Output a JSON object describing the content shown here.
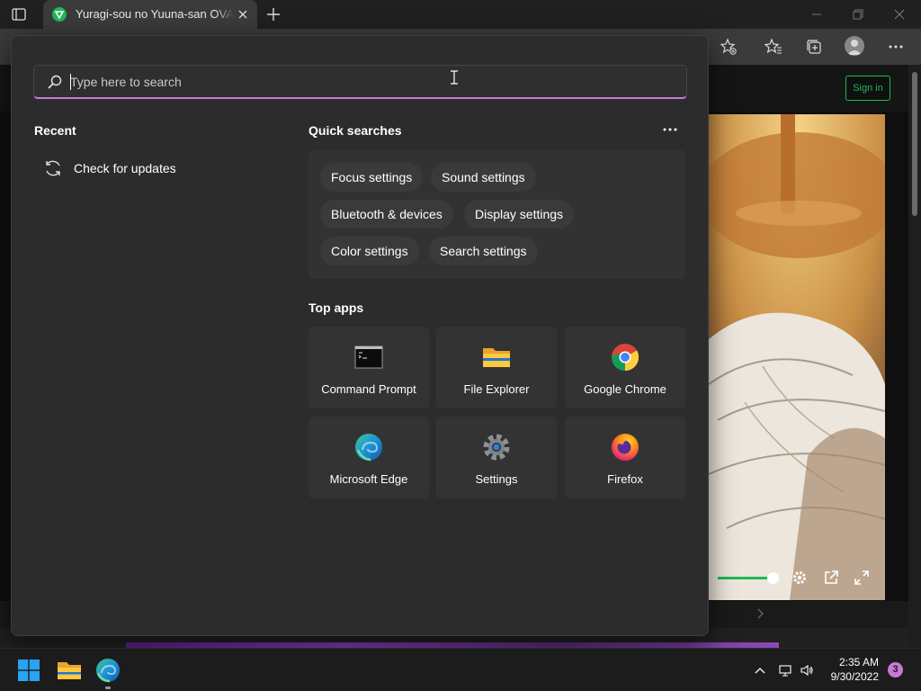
{
  "browser": {
    "tab_title": "Yuragi-sou no Yuuna-san OVA Ep",
    "site_button": "Sign in",
    "accent": "#1db954"
  },
  "flyout": {
    "search": {
      "placeholder": "Type here to search",
      "value": ""
    },
    "recent": {
      "heading": "Recent",
      "items": [
        {
          "label": "Check for updates",
          "icon": "refresh-icon"
        }
      ]
    },
    "quick_searches": {
      "heading": "Quick searches",
      "chips": [
        "Focus settings",
        "Sound settings",
        "Bluetooth & devices",
        "Display settings",
        "Color settings",
        "Search settings"
      ]
    },
    "top_apps": {
      "heading": "Top apps",
      "apps": [
        {
          "label": "Command Prompt",
          "icon": "command-prompt-icon"
        },
        {
          "label": "File Explorer",
          "icon": "file-explorer-icon"
        },
        {
          "label": "Google Chrome",
          "icon": "chrome-icon"
        },
        {
          "label": "Microsoft Edge",
          "icon": "edge-icon"
        },
        {
          "label": "Settings",
          "icon": "settings-icon"
        },
        {
          "label": "Firefox",
          "icon": "firefox-icon"
        }
      ]
    },
    "accent": "#c77dd6"
  },
  "taskbar": {
    "time": "2:35 AM",
    "date": "9/30/2022",
    "notifications": "3"
  }
}
